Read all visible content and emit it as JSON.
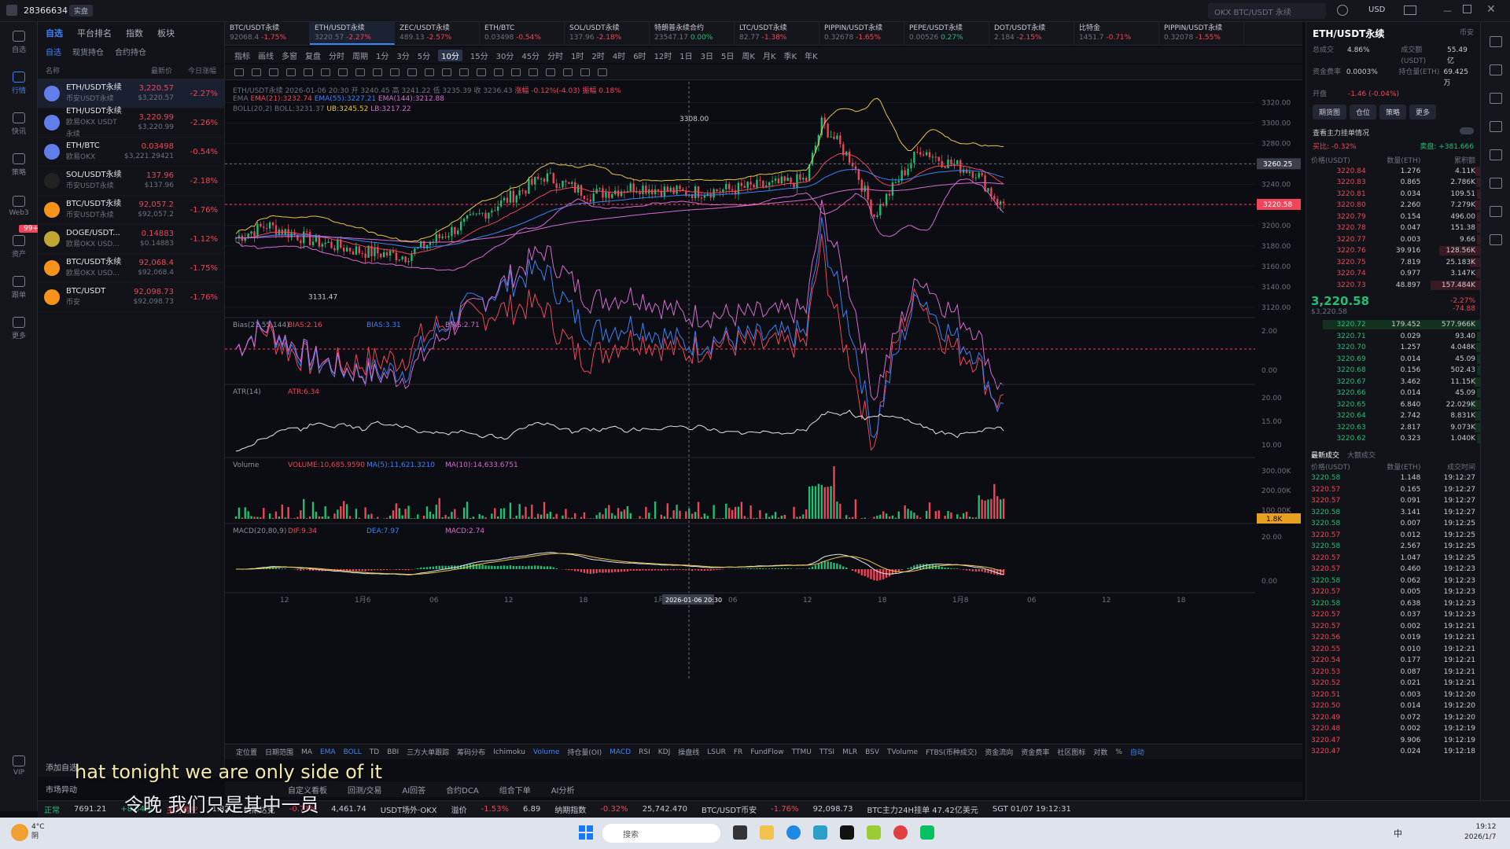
{
  "titlebar": {
    "account": "28366634",
    "badge": "实盘",
    "search_placeholder": "OKX BTC/USDT 永续",
    "currency": "USD"
  },
  "rail": [
    "自选",
    "行情",
    "快讯",
    "策略",
    "Web3",
    "资产",
    "跟单",
    "更多",
    "VIP"
  ],
  "rail_badge": "99+",
  "watchlist": {
    "top_tabs": [
      "自选",
      "平台排名",
      "指数",
      "板块"
    ],
    "sub_tabs": [
      "自选",
      "现货持仓",
      "合约持仓"
    ],
    "headers": [
      "名称",
      "最新价",
      "今日涨幅"
    ],
    "rows": [
      {
        "name": "ETH/USDT永续",
        "sub": "币安USDT永续",
        "price": "3,220.57",
        "price2": "$3,220.57",
        "chg": "-2.27%",
        "color": "#627eea"
      },
      {
        "name": "ETH/USDT永续",
        "sub": "欧易OKX USDT永续",
        "price": "3,220.99",
        "price2": "$3,220.99",
        "chg": "-2.26%",
        "color": "#627eea"
      },
      {
        "name": "ETH/BTC",
        "sub": "欧易OKX",
        "price": "0.03498",
        "price2": "$3,221.29421",
        "chg": "-0.54%",
        "color": "#627eea"
      },
      {
        "name": "SOL/USDT永续",
        "sub": "币安USDT永续",
        "price": "137.96",
        "price2": "$137.96",
        "chg": "-2.18%",
        "color": "#222"
      },
      {
        "name": "BTC/USDT永续",
        "sub": "币安USDT永续",
        "price": "92,057.2",
        "price2": "$92,057.2",
        "chg": "-1.76%",
        "color": "#f7931a"
      },
      {
        "name": "DOGE/USDT...",
        "sub": "欧易OKX USD...",
        "price": "0.14883",
        "price2": "$0.14883",
        "chg": "-1.12%",
        "color": "#c2a633"
      },
      {
        "name": "BTC/USDT永续",
        "sub": "欧易OKX USD...",
        "price": "92,068.4",
        "price2": "$92,068.4",
        "chg": "-1.75%",
        "color": "#f7931a"
      },
      {
        "name": "BTC/USDT",
        "sub": "币安",
        "price": "92,098.73",
        "price2": "$92,098.73",
        "chg": "-1.76%",
        "color": "#f7931a"
      }
    ],
    "add_label": "添加自选",
    "market_label": "市场异动"
  },
  "tabs": [
    {
      "name": "BTC/USDT永续",
      "val": "92068.4",
      "chg": "-1.75%"
    },
    {
      "name": "ETH/USDT永续",
      "val": "3220.57",
      "chg": "-2.27%"
    },
    {
      "name": "ZEC/USDT永续",
      "val": "489.13",
      "chg": "-2.57%"
    },
    {
      "name": "ETH/BTC",
      "val": "0.03498",
      "chg": "-0.54%"
    },
    {
      "name": "SOL/USDT永续",
      "val": "137.96",
      "chg": "-2.18%"
    },
    {
      "name": "特朗普永续合约",
      "val": "23547.17",
      "chg": "0.00%"
    },
    {
      "name": "LTC/USDT永续",
      "val": "82.77",
      "chg": "-1.38%"
    },
    {
      "name": "PIPPIN/USDT永续",
      "val": "0.32678",
      "chg": "-1.65%"
    },
    {
      "name": "PEPE/USDT永续",
      "val": "0.00526",
      "chg": "0.27%"
    },
    {
      "name": "DOT/USDT永续",
      "val": "2.184",
      "chg": "-2.15%"
    },
    {
      "name": "比特金",
      "val": "1451.7",
      "chg": "-0.71%"
    },
    {
      "name": "PIPPIN/USDT永续",
      "val": "0.32078",
      "chg": "-1.55%"
    }
  ],
  "toolbar1": [
    "指标",
    "画线",
    "多窗",
    "复盘",
    "分时",
    "周期",
    "1分",
    "3分",
    "5分",
    "10分",
    "15分",
    "30分",
    "45分",
    "分时",
    "1时",
    "2时",
    "4时",
    "6时",
    "12时",
    "1日",
    "3日",
    "5日",
    "周K",
    "月K",
    "季K",
    "年K"
  ],
  "toolbar1_active": "10分",
  "chart_header": {
    "title": "ETH/USDT永续 2026-01-06 20:30",
    "o": "开 3240.45",
    "h": "高 3241.22",
    "l": "低 3235.39",
    "c": "收 3236.43",
    "chg": "涨幅 -0.12%(-4.03)",
    "amp": "振幅 0.18%",
    "ema": "EMA(21):3232.74",
    "ema2": "EMA(55):3227.21",
    "ema3": "EMA(144):3212.88",
    "boll": "BOLL(20,2) BOLL:3231.37",
    "ub": "UB:3245.52",
    "lb": "LB:3217.22"
  },
  "price_axis": [
    "3320.00",
    "3300.00",
    "3280.00",
    "3260.00",
    "3240.00",
    "3220.00",
    "3200.00",
    "3180.00",
    "3160.00",
    "3140.00",
    "3120.00"
  ],
  "crosshair_price": "3260.25",
  "last_price": "3220.58",
  "high_label": "3308.00",
  "low_label": "3131.47",
  "bias": {
    "label": "Bias(21,55,144)",
    "v1": "BIAS:2.16",
    "v2": "BIAS:3.31",
    "v3": "BIAS:2.71",
    "axis": [
      "2.00",
      "0.00"
    ]
  },
  "atr": {
    "label": "ATR(14)",
    "v": "ATR:6.34",
    "axis": [
      "20.00",
      "15.00",
      "10.00"
    ]
  },
  "volume": {
    "label": "Volume",
    "v": "VOLUME:10,685.9590",
    "ma5": "MA(5):11,621.3210",
    "ma10": "MA(10):14,633.6751",
    "axis": [
      "300.00K",
      "200.00K",
      "100.00K"
    ],
    "last": "1.8K"
  },
  "macd": {
    "label": "MACD(20,80,9)",
    "dif": "DIF:9.34",
    "dea": "DEA:7.97",
    "m": "MACD:2.74",
    "axis": [
      "20.00",
      "0.00"
    ]
  },
  "time_axis": [
    "12",
    "1月6",
    "06",
    "12",
    "18",
    "1月7",
    "06",
    "12",
    "18",
    "1月8",
    "06",
    "12",
    "18"
  ],
  "crosshair_time": "2026-01-06 20:30",
  "indicator_bar": [
    "定位置",
    "日期范围",
    "MA",
    "EMA",
    "BOLL",
    "TD",
    "BBI",
    "三方大单跟踪",
    "筹码分布",
    "Ichimoku",
    "Volume",
    "持仓量(OI)",
    "MACD",
    "RSI",
    "KDJ",
    "操盘线",
    "LSUR",
    "FR",
    "FundFlow",
    "TTMU",
    "TTSI",
    "MLR",
    "BSV",
    "TVolume",
    "FTBS(币种成交)",
    "资金流向",
    "资金费率",
    "社区图标",
    "对数",
    "%",
    "自动"
  ],
  "bottom_tabs": [
    "自定义看板",
    "回测/交易",
    "AI回答",
    "合约DCA",
    "组合下单",
    "AI分析"
  ],
  "right": {
    "title": "ETH/USDT永续",
    "exchange": "币安",
    "stats": [
      [
        "总成交",
        "4.86%",
        "成交额(USDT)",
        "55.49亿"
      ],
      [
        "资金费率",
        "0.0003%",
        "持仓量(ETH)",
        "69.425万"
      ],
      [
        "开盘",
        "-1.46 (-0.04%)",
        "",
        ""
      ]
    ],
    "buttons": [
      "期货图",
      "仓位",
      "策略",
      "更多"
    ],
    "ob_title": "查看主力挂单情况",
    "ob_ratio_l": "买比: -0.32%",
    "ob_ratio_r": "卖盘: +381.666",
    "ob_headers": [
      "价格(USDT)",
      "数量(ETH)",
      "累积额"
    ],
    "asks": [
      [
        "3220.84",
        "1.276",
        "4.11K"
      ],
      [
        "3220.83",
        "0.865",
        "2.786K"
      ],
      [
        "3220.81",
        "0.034",
        "109.51"
      ],
      [
        "3220.80",
        "2.260",
        "7.279K"
      ],
      [
        "3220.79",
        "0.154",
        "496.00"
      ],
      [
        "3220.78",
        "0.047",
        "151.38"
      ],
      [
        "3220.77",
        "0.003",
        "9.66"
      ],
      [
        "3220.76",
        "39.916",
        "128.56K"
      ],
      [
        "3220.75",
        "7.819",
        "25.183K"
      ],
      [
        "3220.74",
        "0.977",
        "3.147K"
      ],
      [
        "3220.73",
        "48.897",
        "157.484K"
      ]
    ],
    "mid": "3,220.58",
    "mid_sub": "$3,220.58",
    "mid_chg": "-2.27%",
    "mid_chg2": "-74.88",
    "bids": [
      [
        "3220.72",
        "179.452",
        "577.966K"
      ],
      [
        "3220.71",
        "0.029",
        "93.40"
      ],
      [
        "3220.70",
        "1.257",
        "4.048K"
      ],
      [
        "3220.69",
        "0.014",
        "45.09"
      ],
      [
        "3220.68",
        "0.156",
        "502.43"
      ],
      [
        "3220.67",
        "3.462",
        "11.15K"
      ],
      [
        "3220.66",
        "0.014",
        "45.09"
      ],
      [
        "3220.65",
        "6.840",
        "22.029K"
      ],
      [
        "3220.64",
        "2.742",
        "8.831K"
      ],
      [
        "3220.63",
        "2.817",
        "9.073K"
      ],
      [
        "3220.62",
        "0.323",
        "1.040K"
      ]
    ],
    "trades_title": "最新成交",
    "trades_tab2": "大额成交",
    "trade_headers": [
      "价格(USDT)",
      "数量(ETH)",
      "成交时间"
    ],
    "trades": [
      [
        "3220.58",
        "1.148",
        "19:12:27"
      ],
      [
        "3220.57",
        "0.165",
        "19:12:27"
      ],
      [
        "3220.57",
        "0.091",
        "19:12:27"
      ],
      [
        "3220.58",
        "3.141",
        "19:12:27"
      ],
      [
        "3220.58",
        "0.007",
        "19:12:25"
      ],
      [
        "3220.57",
        "0.012",
        "19:12:25"
      ],
      [
        "3220.58",
        "2.567",
        "19:12:25"
      ],
      [
        "3220.57",
        "1.047",
        "19:12:25"
      ],
      [
        "3220.57",
        "0.460",
        "19:12:23"
      ],
      [
        "3220.58",
        "0.062",
        "19:12:23"
      ],
      [
        "3220.57",
        "0.005",
        "19:12:23"
      ],
      [
        "3220.58",
        "0.638",
        "19:12:23"
      ],
      [
        "3220.57",
        "0.037",
        "19:12:23"
      ],
      [
        "3220.57",
        "0.002",
        "19:12:21"
      ],
      [
        "3220.56",
        "0.019",
        "19:12:21"
      ],
      [
        "3220.55",
        "0.010",
        "19:12:21"
      ],
      [
        "3220.54",
        "0.177",
        "19:12:21"
      ],
      [
        "3220.53",
        "0.087",
        "19:12:21"
      ],
      [
        "3220.52",
        "0.021",
        "19:12:21"
      ],
      [
        "3220.51",
        "0.003",
        "19:12:20"
      ],
      [
        "3220.50",
        "0.014",
        "19:12:20"
      ],
      [
        "3220.49",
        "0.072",
        "19:12:20"
      ],
      [
        "3220.48",
        "0.002",
        "19:12:19"
      ],
      [
        "3220.47",
        "9.906",
        "19:12:19"
      ],
      [
        "3220.47",
        "0.024",
        "19:12:18"
      ],
      [
        "3220.47",
        "3.714",
        "19:12:18"
      ]
    ]
  },
  "ticker": [
    "正常",
    "7691.21",
    "+8.54%",
    "主力看空",
    "1.82",
    "纳斯达克",
    "-0.71%",
    "4,461.74",
    "USDT场外·OKX",
    "溢价",
    "-1.53%",
    "6.89",
    "纳期指数",
    "-0.32%",
    "25,742.470",
    "BTC/USDT币安",
    "-1.76%",
    "92,098.73",
    "BTC主力24H挂单 47.42亿美元",
    "SGT 01/07 19:12:31"
  ],
  "subtitle_en": "hat tonight we are only side of it",
  "subtitle_zh": "令晚 我们只是其中一员",
  "taskbar": {
    "weather": "4°C",
    "weather2": "阴",
    "search": "搜索",
    "time": "19:12",
    "date": "2026/1/7",
    "lang": "中"
  }
}
